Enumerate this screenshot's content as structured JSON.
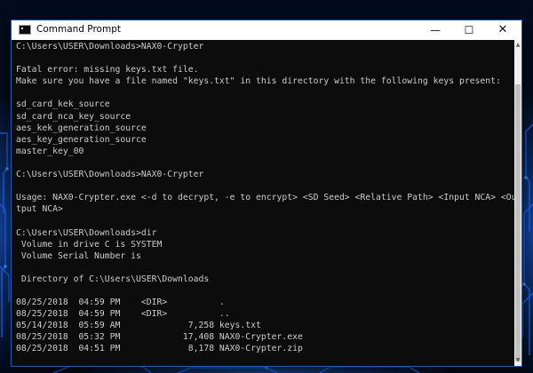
{
  "window": {
    "title": "Command Prompt",
    "minimize_glyph": "—",
    "maximize_glyph": "☐",
    "close_glyph": "✕"
  },
  "icons": {
    "app": "command-prompt-icon",
    "scroll_up": "arrow-up-icon",
    "scroll_down": "arrow-down-icon"
  },
  "colors": {
    "console_bg": "#0c0c0c",
    "console_text": "#cccccc",
    "titlebar_bg": "#ffffff",
    "desktop_glow": "#1e6eff"
  },
  "scrollbar": {
    "up_glyph": "▲",
    "down_glyph": "▼"
  },
  "console": {
    "lines": [
      "C:\\Users\\USER\\Downloads>NAX0-Crypter",
      "",
      "Fatal error: missing keys.txt file.",
      "Make sure you have a file named \"keys.txt\" in this directory with the following keys present:",
      "",
      "sd_card_kek_source",
      "sd_card_nca_key_source",
      "aes_kek_generation_source",
      "aes_key_generation_source",
      "master_key_00",
      "",
      "C:\\Users\\USER\\Downloads>NAX0-Crypter",
      "",
      "Usage: NAX0-Crypter.exe <-d to decrypt, -e to encrypt> <SD Seed> <Relative Path> <Input NCA> <Ou",
      "tput NCA>",
      "",
      "C:\\Users\\USER\\Downloads>dir",
      " Volume in drive C is SYSTEM",
      " Volume Serial Number is",
      "",
      " Directory of C:\\Users\\USER\\Downloads",
      "",
      "08/25/2018  04:59 PM    <DIR>          .",
      "08/25/2018  04:59 PM    <DIR>          ..",
      "05/14/2018  05:59 AM             7,258 keys.txt",
      "08/25/2018  05:32 PM            17,408 NAX0-Crypter.exe",
      "08/25/2018  04:51 PM             8,178 NAX0-Crypter.zip"
    ]
  }
}
